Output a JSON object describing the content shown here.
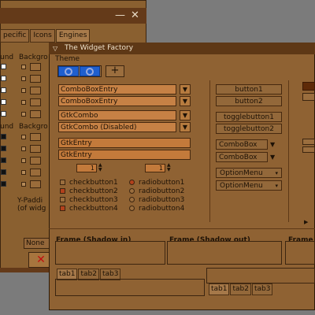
{
  "bg_window": {
    "minimize_glyph": "—",
    "close_glyph": "✕",
    "tabs": [
      "pecific",
      "Icons",
      "Engines"
    ],
    "row1_labels": [
      "und",
      "Backgro"
    ],
    "row2_labels": [
      "und",
      "Backgro"
    ],
    "ypadding_label": "Y-Paddi",
    "of_widget_label": "(of widg",
    "none_value": "None",
    "close_x_glyph": "✕"
  },
  "main_window": {
    "title": "The Widget Factory",
    "theme_menu": "Theme",
    "toolbar_add_glyph": "+",
    "combo_entries": [
      "ComboBoxEntry",
      "ComboBoxEntry"
    ],
    "gtk_combos": [
      "GtkCombo",
      "GtkCombo (Disabled)"
    ],
    "entries": [
      "GtkEntry",
      "GtkEntry"
    ],
    "spin_values": [
      "1",
      "1"
    ],
    "checkbuttons": [
      "checkbutton1",
      "checkbutton2",
      "checkbutton3",
      "checkbutton4"
    ],
    "radiobuttons": [
      "radiobutton1",
      "radiobutton2",
      "radiobutton3",
      "radiobutton4"
    ],
    "buttons": [
      "button1",
      "button2"
    ],
    "togglebuttons": [
      "togglebutton1",
      "togglebutton2"
    ],
    "comboboxes": [
      "ComboBox",
      "ComboBox"
    ],
    "optionmenus": [
      "OptionMenu",
      "OptionMenu"
    ],
    "frames": [
      "Frame (Shadow in)",
      "Frame (Shadow out)",
      "Frame"
    ],
    "tabs_left": [
      "tab1",
      "tab2",
      "tab3"
    ],
    "tabs_right": [
      "tab1",
      "tab2",
      "tab3"
    ]
  }
}
